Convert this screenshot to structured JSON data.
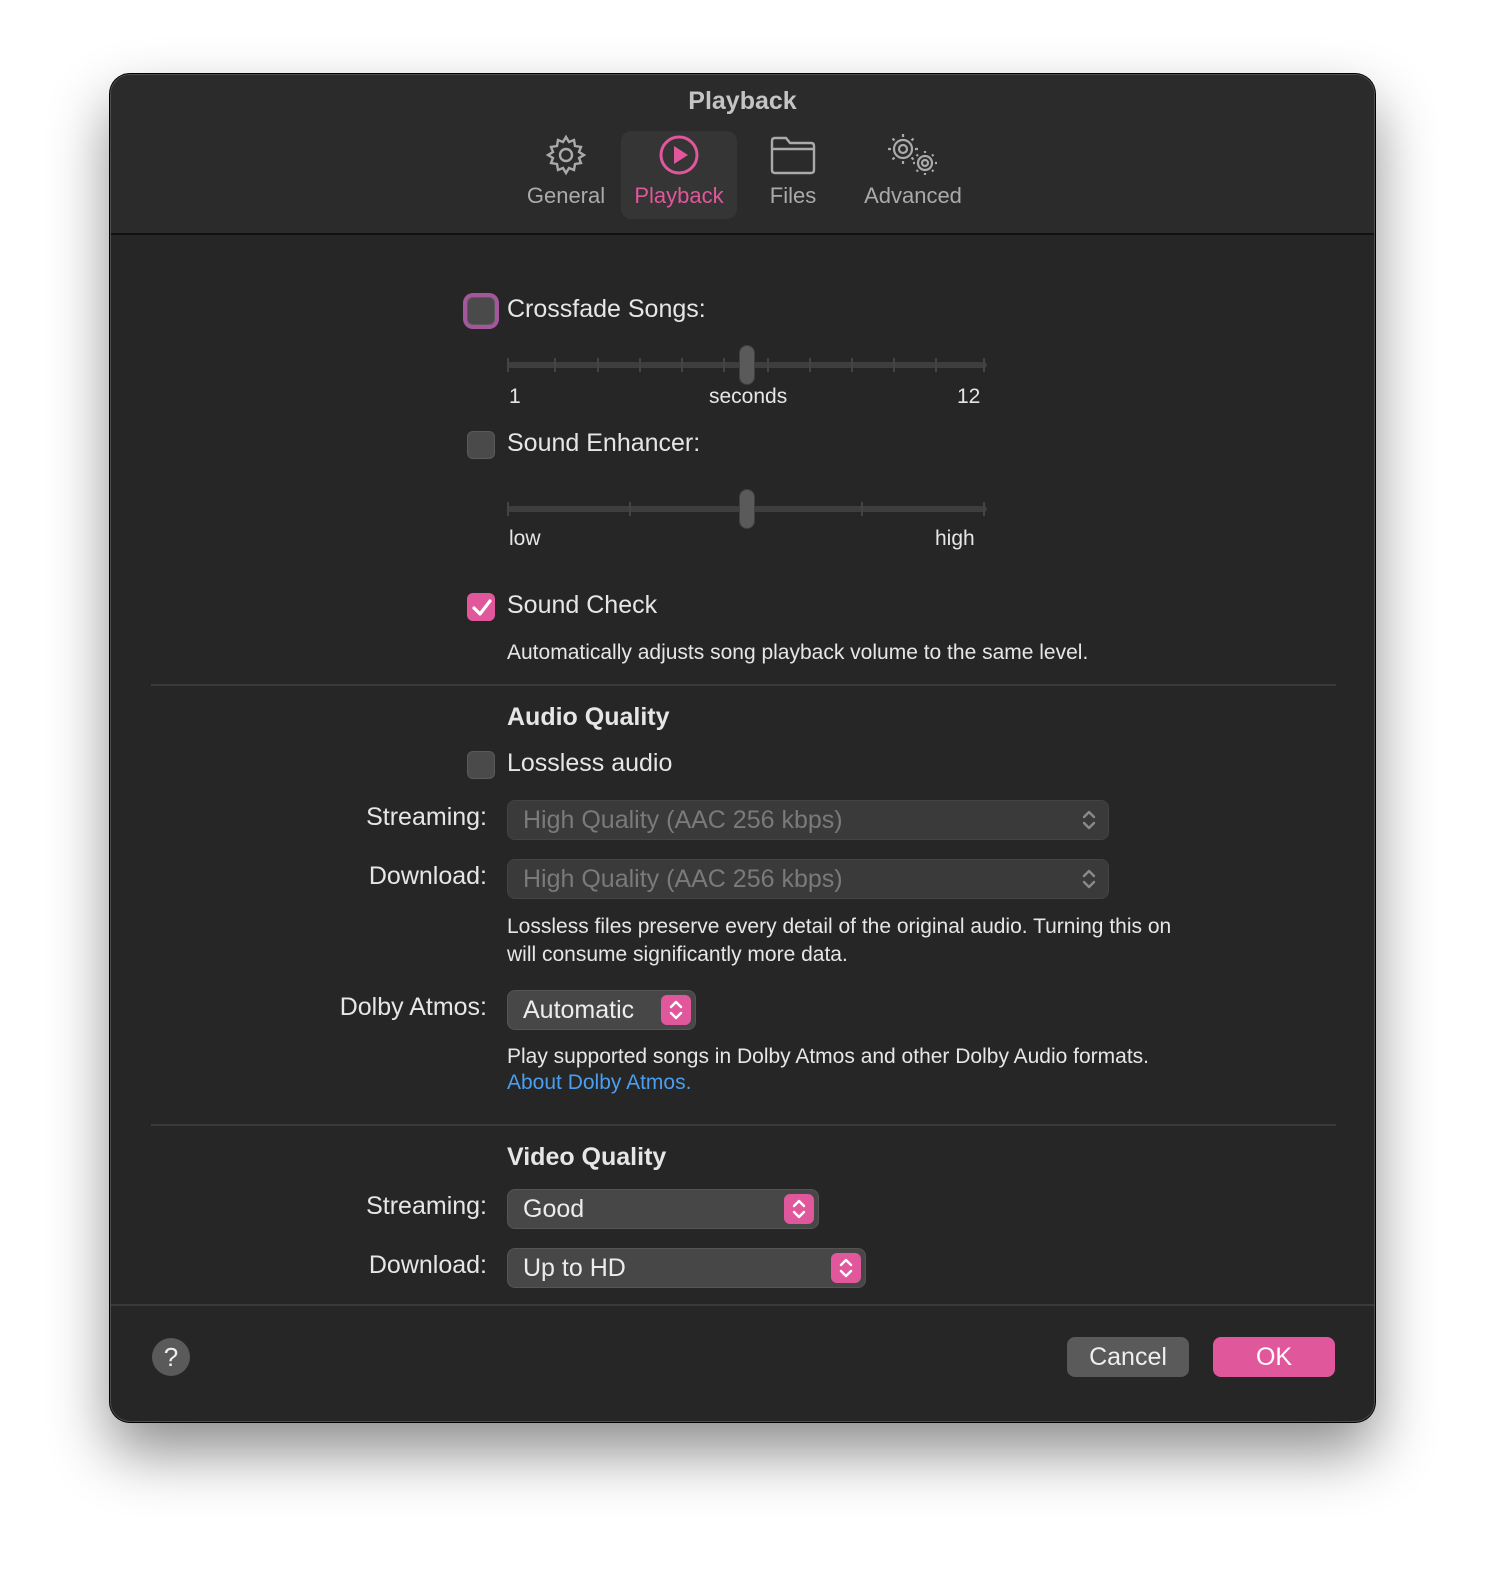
{
  "window": {
    "title": "Playback"
  },
  "tabs": [
    {
      "label": "General",
      "icon": "gear-icon",
      "active": false
    },
    {
      "label": "Playback",
      "icon": "play-circle-icon",
      "active": true
    },
    {
      "label": "Files",
      "icon": "folder-icon",
      "active": false
    },
    {
      "label": "Advanced",
      "icon": "gears-icon",
      "active": false
    }
  ],
  "crossfade": {
    "label": "Crossfade Songs:",
    "checked": false,
    "min_label": "1",
    "unit_label": "seconds",
    "max_label": "12",
    "value_fraction": 0.5
  },
  "sound_enhancer": {
    "label": "Sound Enhancer:",
    "checked": false,
    "min_label": "low",
    "max_label": "high",
    "value_fraction": 0.5
  },
  "sound_check": {
    "label": "Sound Check",
    "checked": true,
    "description": "Automatically adjusts song playback volume to the same level."
  },
  "audio_quality": {
    "heading": "Audio Quality",
    "lossless_label": "Lossless audio",
    "lossless_checked": false,
    "streaming_label": "Streaming:",
    "streaming_value": "High Quality (AAC 256 kbps)",
    "download_label": "Download:",
    "download_value": "High Quality (AAC 256 kbps)",
    "lossless_note_line1": "Lossless files preserve every detail of the original audio. Turning this on",
    "lossless_note_line2": "will consume significantly more data.",
    "dolby_label": "Dolby Atmos:",
    "dolby_value": "Automatic",
    "dolby_note": "Play supported songs in Dolby Atmos and other Dolby Audio formats.",
    "dolby_link": "About Dolby Atmos."
  },
  "video_quality": {
    "heading": "Video Quality",
    "streaming_label": "Streaming:",
    "streaming_value": "Good",
    "download_label": "Download:",
    "download_value": "Up to HD"
  },
  "footer": {
    "help_label": "?",
    "cancel_label": "Cancel",
    "ok_label": "OK"
  },
  "colors": {
    "accent": "#e0579b",
    "link": "#4a9ef0",
    "background": "#262626"
  }
}
